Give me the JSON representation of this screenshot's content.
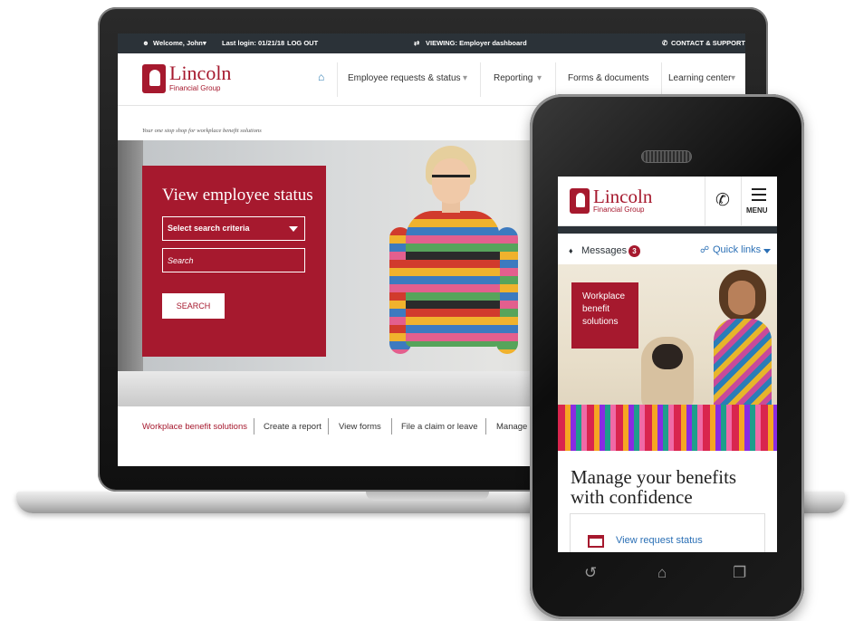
{
  "desktop": {
    "topbar": {
      "welcome": "Welcome, John",
      "last_login": "Last login: 01/21/18",
      "logout": "LOG OUT",
      "viewing": "VIEWING: Employer dashboard",
      "contact": "CONTACT & SUPPORT"
    },
    "logo": {
      "word": "Lincoln",
      "sub": "Financial Group"
    },
    "nav": [
      "Employee requests & status",
      "Reporting",
      "Forms & documents",
      "Learning center"
    ],
    "tagline": "Your one stop shop for workplace benefit solutions",
    "search_panel": {
      "title": "View employee status",
      "select": "Select search criteria",
      "search_placeholder": "Search",
      "button": "SEARCH"
    },
    "quick_links": [
      "Workplace benefit solutions",
      "Create a report",
      "View forms",
      "File a claim or leave",
      "Manage pr"
    ]
  },
  "mobile": {
    "logo": {
      "word": "Lincoln",
      "sub": "Financial Group"
    },
    "menu_label": "MENU",
    "messages": "Messages",
    "messages_count": "3",
    "quick_links": "Quick links",
    "hero_card": "Workplace benefit solutions",
    "headline": "Manage your benefits with confidence",
    "tile": "View request status"
  },
  "colors": {
    "brand_red": "#a6192e",
    "dark_bar": "#2b3238",
    "link_blue": "#2a6fb5"
  },
  "icons": [
    "user-icon",
    "swap-icon",
    "phone-icon",
    "home-icon",
    "bell-icon",
    "link-icon",
    "menu-icon",
    "calendar-icon",
    "back-icon",
    "home-button-icon",
    "recent-apps-icon"
  ]
}
